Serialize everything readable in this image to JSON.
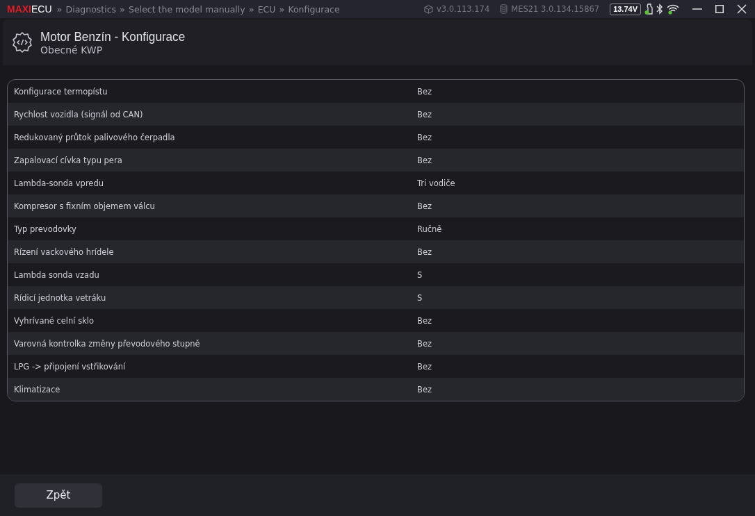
{
  "logo": {
    "brand": "MAXI",
    "product": "ECU"
  },
  "breadcrumbs": [
    {
      "separator": "»",
      "label": "Diagnostics"
    },
    {
      "separator": "»",
      "label": "Select the model manually"
    },
    {
      "separator": "»",
      "label": "ECU"
    },
    {
      "separator": "»",
      "label": "Konfigurace"
    }
  ],
  "status": {
    "app_version": "v3.0.113.174",
    "device_version": "MES21 3.0.134.15867",
    "voltage": "13.74V"
  },
  "header": {
    "title": "Motor Benzín - Konfigurace",
    "subtitle": "Obecné KWP"
  },
  "rows": [
    {
      "name": "Konfigurace termopístu",
      "value": "Bez"
    },
    {
      "name": "Rychlost vozidla (signál od CAN)",
      "value": "Bez"
    },
    {
      "name": "Redukovaný průtok palivového čerpadla",
      "value": "Bez"
    },
    {
      "name": "Zapalovací cívka typu pera",
      "value": "Bez"
    },
    {
      "name": "Lambda-sonda vpredu",
      "value": "Tri vodiče"
    },
    {
      "name": "Kompresor s fixním objemem válcu",
      "value": "Bez"
    },
    {
      "name": "Typ prevodovky",
      "value": "Ručně"
    },
    {
      "name": "Rízení vackového hrídele",
      "value": "Bez"
    },
    {
      "name": "Lambda sonda vzadu",
      "value": "S"
    },
    {
      "name": "Rídicí jednotka vetráku",
      "value": "S"
    },
    {
      "name": "Vyhrívané celní sklo",
      "value": "Bez"
    },
    {
      "name": "Varovná kontrolka změny převodového stupně",
      "value": "Bez"
    },
    {
      "name": "LPG -> připojení vstřikování",
      "value": "Bez"
    },
    {
      "name": "Klimatizace",
      "value": "Bez"
    }
  ],
  "footer": {
    "back_button": "Zpět"
  }
}
